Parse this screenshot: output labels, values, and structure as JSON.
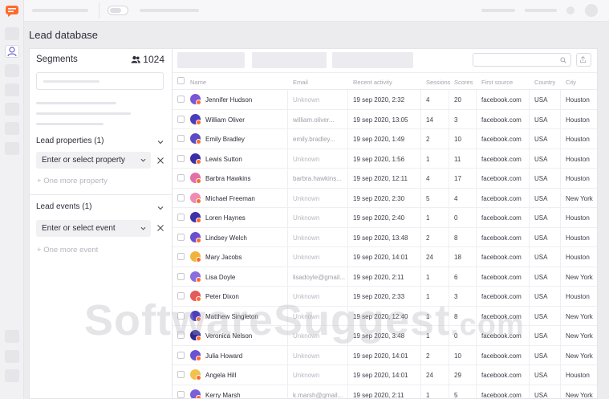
{
  "page": {
    "title": "Lead database"
  },
  "segments": {
    "title": "Segments",
    "count": "1024",
    "lead_properties": {
      "title": "Lead properties (1)",
      "select_placeholder": "Enter or select property",
      "add_label": "One more property"
    },
    "lead_events": {
      "title": "Lead events (1)",
      "select_placeholder": "Enter or select event",
      "add_label": "One more event"
    }
  },
  "table": {
    "columns": [
      "Name",
      "Email",
      "Recent activity",
      "Sessions",
      "Scores",
      "First source",
      "Country",
      "City"
    ],
    "rows": [
      {
        "name": "Jennifer Hudson",
        "email": "Unknown",
        "activity": "19 sep 2020, 2:32",
        "sessions": "4",
        "scores": "20",
        "source": "facebook.com",
        "country": "USA",
        "city": "Houston",
        "avatar": "#7b57d6"
      },
      {
        "name": "William Oliver",
        "email": "william.oliver...",
        "activity": "19 sep 2020, 13:05",
        "sessions": "14",
        "scores": "3",
        "source": "facebook.com",
        "country": "USA",
        "city": "Houston",
        "avatar": "#4a3db7"
      },
      {
        "name": "Emily Bradley",
        "email": "emily.bradley...",
        "activity": "19 sep 2020, 1:49",
        "sessions": "2",
        "scores": "10",
        "source": "facebook.com",
        "country": "USA",
        "city": "Houston",
        "avatar": "#5b4bc4"
      },
      {
        "name": "Lewis Sutton",
        "email": "Unknown",
        "activity": "19 sep 2020, 1:56",
        "sessions": "1",
        "scores": "11",
        "source": "facebook.com",
        "country": "USA",
        "city": "Houston",
        "avatar": "#3b2fa8"
      },
      {
        "name": "Barbra Hawkins",
        "email": "barbra.hawkins...",
        "activity": "19 sep 2020, 12:11",
        "sessions": "4",
        "scores": "17",
        "source": "facebook.com",
        "country": "USA",
        "city": "Houston",
        "avatar": "#e26fa6"
      },
      {
        "name": "Michael Freeman",
        "email": "Unknown",
        "activity": "19 sep 2020, 2:30",
        "sessions": "5",
        "scores": "4",
        "source": "facebook.com",
        "country": "USA",
        "city": "New York",
        "avatar": "#f08ab0"
      },
      {
        "name": "Loren Haynes",
        "email": "Unknown",
        "activity": "19 sep 2020, 2:40",
        "sessions": "1",
        "scores": "0",
        "source": "facebook.com",
        "country": "USA",
        "city": "Houston",
        "avatar": "#3d33a6"
      },
      {
        "name": "Lindsey Welch",
        "email": "Unknown",
        "activity": "19 sep 2020, 13:48",
        "sessions": "2",
        "scores": "8",
        "source": "facebook.com",
        "country": "USA",
        "city": "Houston",
        "avatar": "#6b4fcf"
      },
      {
        "name": "Mary Jacobs",
        "email": "Unknown",
        "activity": "19 sep 2020, 14:01",
        "sessions": "24",
        "scores": "18",
        "source": "facebook.com",
        "country": "USA",
        "city": "Houston",
        "avatar": "#f0b43c"
      },
      {
        "name": "Lisa Doyle",
        "email": "lisadoyle@gmail...",
        "activity": "19 sep 2020, 2:11",
        "sessions": "1",
        "scores": "6",
        "source": "facebook.com",
        "country": "USA",
        "city": "New York",
        "avatar": "#8a6ee0"
      },
      {
        "name": "Peter Dixon",
        "email": "Unknown",
        "activity": "19 sep 2020, 2:33",
        "sessions": "1",
        "scores": "3",
        "source": "facebook.com",
        "country": "USA",
        "city": "Houston",
        "avatar": "#e45a5a"
      },
      {
        "name": "Matthew Singleton",
        "email": "Unknown",
        "activity": "19 sep 2020, 12:40",
        "sessions": "1",
        "scores": "8",
        "source": "facebook.com",
        "country": "USA",
        "city": "New York",
        "avatar": "#4c3fbf"
      },
      {
        "name": "Veronica Nelson",
        "email": "Unknown",
        "activity": "19 sep 2020, 3:48",
        "sessions": "1",
        "scores": "0",
        "source": "facebook.com",
        "country": "USA",
        "city": "New York",
        "avatar": "#2f2896"
      },
      {
        "name": "Julia Howard",
        "email": "Unknown",
        "activity": "19 sep 2020, 14:01",
        "sessions": "2",
        "scores": "10",
        "source": "facebook.com",
        "country": "USA",
        "city": "New York",
        "avatar": "#6a52d0"
      },
      {
        "name": "Angela Hill",
        "email": "Unknown",
        "activity": "19 sep 2020, 14:01",
        "sessions": "24",
        "scores": "29",
        "source": "facebook.com",
        "country": "USA",
        "city": "Houston",
        "avatar": "#f2c14e"
      },
      {
        "name": "Kerry Marsh",
        "email": "k.marsh@gmail...",
        "activity": "19 sep 2020, 2:11",
        "sessions": "1",
        "scores": "5",
        "source": "facebook.com",
        "country": "USA",
        "city": "New York",
        "avatar": "#7a5fd9"
      }
    ]
  },
  "watermark": {
    "text": "SoftwareSuggest",
    "suffix": ".com"
  },
  "colors": {
    "accent": "#ff6a2b",
    "rail": "#f1f1f4",
    "avatar_badge": "#ff6a2b"
  },
  "icons": {
    "logo": "chat-logo-icon",
    "users": "users-icon",
    "chevron": "chevron-down-icon",
    "close": "close-icon",
    "plus": "plus-icon",
    "search": "search-icon",
    "export": "export-icon"
  }
}
